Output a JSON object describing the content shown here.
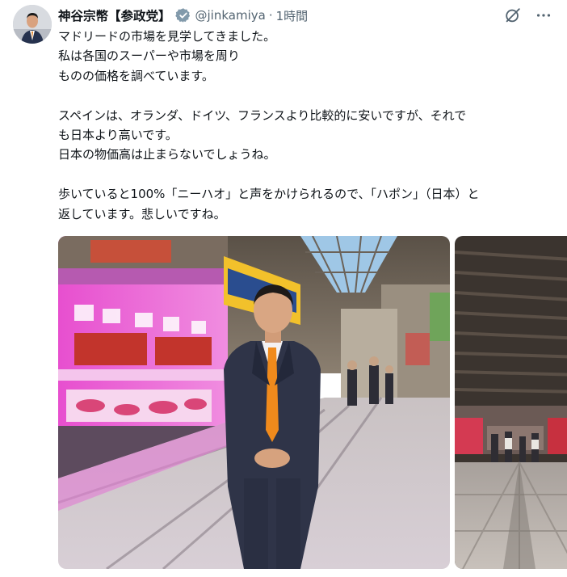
{
  "post": {
    "display_name": "神谷宗幣【参政党】",
    "handle": "@jinkamiya",
    "separator": "·",
    "time": "1時間",
    "lines": [
      "マドリードの市場を見学してきました。",
      "私は各国のスーパーや市場を周り",
      "ものの価格を調べています。",
      "",
      "スペインは、オランダ、ドイツ、フランスより比較的に安いですが、それで",
      "も日本より高いです。",
      "日本の物価高は止まらないでしょうね。",
      "",
      "歩いていると100%「ニーハオ」と声をかけられるので、「ハポン」（日本）と",
      "返しています。悲しいですね。"
    ]
  },
  "icons": {
    "verified": "verified-badge-icon",
    "grok": "grok-icon",
    "more": "more-options-icon"
  },
  "colors": {
    "verified_badge": "#829aab",
    "secondary_text": "#536471",
    "text": "#0f1419",
    "market_pink": "#e05ccb",
    "tie_orange": "#f08a1c"
  }
}
